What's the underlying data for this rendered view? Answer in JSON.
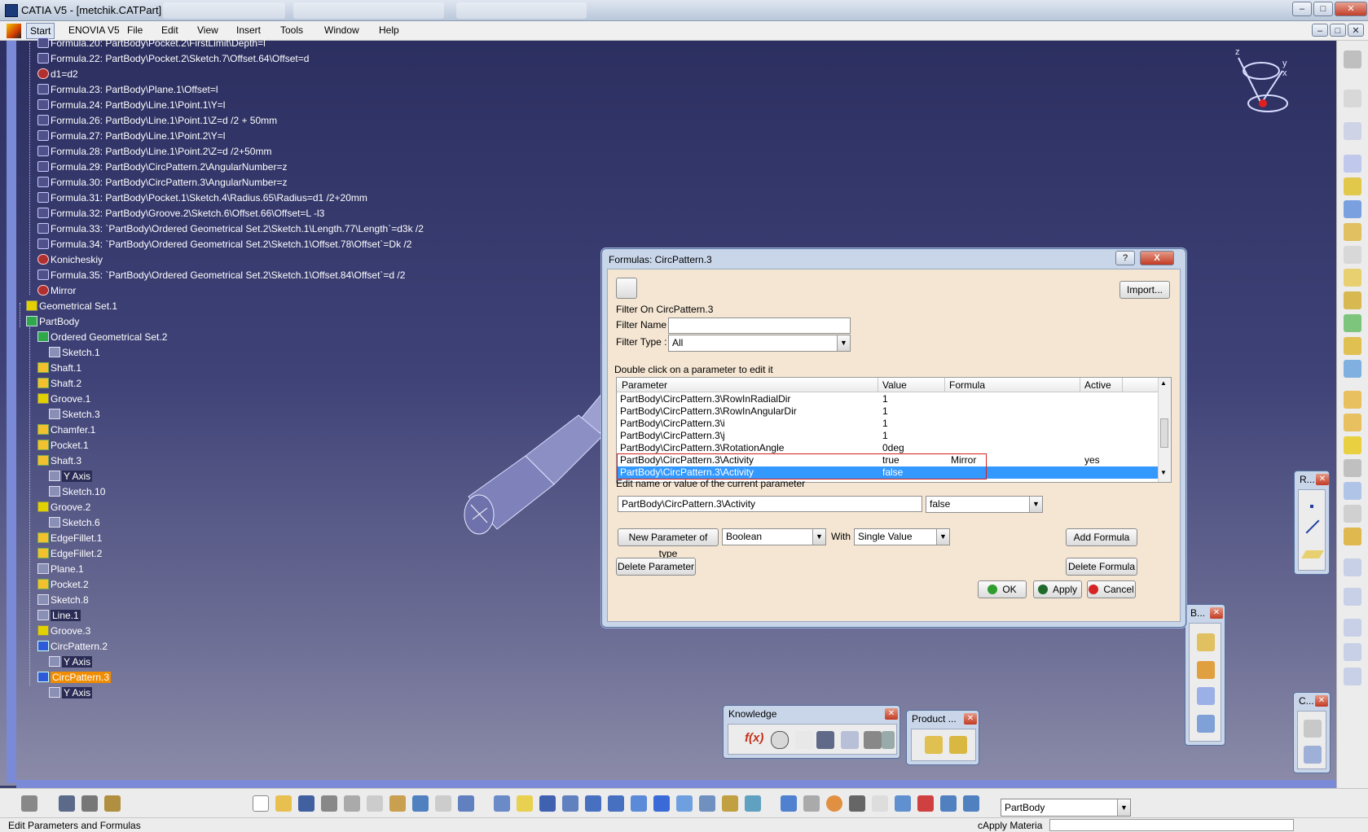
{
  "window": {
    "title": "CATIA V5 - [metchik.CATPart]"
  },
  "menu": {
    "items": [
      "Start",
      "ENOVIA V5",
      "File",
      "Edit",
      "View",
      "Insert",
      "Tools",
      "Window",
      "Help"
    ]
  },
  "tree": {
    "rows": [
      {
        "label": "Formula.20: PartBody\\Pocket.2\\FirstLimit\\Depth=l",
        "icon": "formula-icon"
      },
      {
        "label": "Formula.22: PartBody\\Pocket.2\\Sketch.7\\Offset.64\\Offset=d",
        "icon": "formula-icon"
      },
      {
        "label": "d1=d2",
        "icon": "rule-icon"
      },
      {
        "label": "Formula.23: PartBody\\Plane.1\\Offset=l",
        "icon": "formula-icon"
      },
      {
        "label": "Formula.24: PartBody\\Line.1\\Point.1\\Y=l",
        "icon": "formula-icon"
      },
      {
        "label": "Formula.26: PartBody\\Line.1\\Point.1\\Z=d /2 + 50mm",
        "icon": "formula-icon"
      },
      {
        "label": "Formula.27: PartBody\\Line.1\\Point.2\\Y=l",
        "icon": "formula-icon"
      },
      {
        "label": "Formula.28: PartBody\\Line.1\\Point.2\\Z=d /2+50mm",
        "icon": "formula-icon"
      },
      {
        "label": "Formula.29: PartBody\\CircPattern.2\\AngularNumber=z",
        "icon": "formula-icon"
      },
      {
        "label": "Formula.30: PartBody\\CircPattern.3\\AngularNumber=z",
        "icon": "formula-icon"
      },
      {
        "label": "Formula.31: PartBody\\Pocket.1\\Sketch.4\\Radius.65\\Radius=d1 /2+20mm",
        "icon": "formula-icon"
      },
      {
        "label": "Formula.32: PartBody\\Groove.2\\Sketch.6\\Offset.66\\Offset=L -l3",
        "icon": "formula-icon"
      },
      {
        "label": "Formula.33: `PartBody\\Ordered Geometrical Set.2\\Sketch.1\\Length.77\\Length`=d3k /2",
        "icon": "formula-icon"
      },
      {
        "label": "Formula.34: `PartBody\\Ordered Geometrical Set.2\\Sketch.1\\Offset.78\\Offset`=Dk /2",
        "icon": "formula-icon"
      },
      {
        "label": "Konicheskiy",
        "icon": "rule-icon"
      },
      {
        "label": "Formula.35: `PartBody\\Ordered Geometrical Set.2\\Sketch.1\\Offset.84\\Offset`=d /2",
        "icon": "formula-icon"
      },
      {
        "label": "Mirror",
        "icon": "rule-icon"
      },
      {
        "label": "Geometrical Set.1",
        "icon": "geoset-icon"
      },
      {
        "label": "PartBody",
        "icon": "partbody-icon"
      },
      {
        "label": "Ordered Geometrical Set.2",
        "icon": "geoset-icon"
      },
      {
        "label": "Sketch.1",
        "icon": "sketch-icon"
      },
      {
        "label": "Shaft.1",
        "icon": "shaft-icon"
      },
      {
        "label": "Shaft.2",
        "icon": "shaft-icon"
      },
      {
        "label": "Groove.1",
        "icon": "groove-icon"
      },
      {
        "label": "Sketch.3",
        "icon": "sketch-icon"
      },
      {
        "label": "Chamfer.1",
        "icon": "chamfer-icon"
      },
      {
        "label": "Pocket.1",
        "icon": "pocket-icon"
      },
      {
        "label": "Shaft.3",
        "icon": "shaft-icon"
      },
      {
        "label": "Y Axis",
        "icon": "axis-icon"
      },
      {
        "label": "Sketch.10",
        "icon": "sketch-icon"
      },
      {
        "label": "Groove.2",
        "icon": "groove-icon"
      },
      {
        "label": "Sketch.6",
        "icon": "sketch-icon"
      },
      {
        "label": "EdgeFillet.1",
        "icon": "fillet-icon"
      },
      {
        "label": "EdgeFillet.2",
        "icon": "fillet-icon"
      },
      {
        "label": "Plane.1",
        "icon": "plane-icon"
      },
      {
        "label": "Pocket.2",
        "icon": "pocket-icon"
      },
      {
        "label": "Sketch.8",
        "icon": "sketch-icon"
      },
      {
        "label": "Line.1",
        "icon": "line-icon"
      },
      {
        "label": "Groove.3",
        "icon": "groove-icon"
      },
      {
        "label": "CircPattern.2",
        "icon": "pattern-icon"
      },
      {
        "label": "Y Axis",
        "icon": "axis-icon"
      },
      {
        "label": "CircPattern.3",
        "icon": "pattern-icon",
        "selected": true
      },
      {
        "label": "Y Axis",
        "icon": "axis-icon"
      }
    ]
  },
  "compass": {
    "z": "z",
    "y": "y",
    "x": "x"
  },
  "dialog": {
    "title": "Formulas: CircPattern.3",
    "help": "?",
    "close": "X",
    "import_label": "Import...",
    "filter_on": "Filter On CircPattern.3",
    "filter_name_label": "Filter Name :",
    "filter_name_value": "",
    "filter_type_label": "Filter Type :",
    "filter_type_value": "All",
    "instruction": "Double click on a parameter to edit it",
    "columns": {
      "parameter": "Parameter",
      "value": "Value",
      "formula": "Formula",
      "active": "Active"
    },
    "rows": [
      {
        "parameter": "PartBody\\CircPattern.3\\RowInRadialDir",
        "value": "1",
        "formula": "",
        "active": ""
      },
      {
        "parameter": "PartBody\\CircPattern.3\\RowInAngularDir",
        "value": "1",
        "formula": "",
        "active": ""
      },
      {
        "parameter": "PartBody\\CircPattern.3\\i",
        "value": "1",
        "formula": "",
        "active": ""
      },
      {
        "parameter": "PartBody\\CircPattern.3\\j",
        "value": "1",
        "formula": "",
        "active": ""
      },
      {
        "parameter": "PartBody\\CircPattern.3\\RotationAngle",
        "value": "0deg",
        "formula": "",
        "active": ""
      },
      {
        "parameter": "PartBody\\CircPattern.3\\Activity",
        "value": "true",
        "formula": "Mirror",
        "active": "yes"
      },
      {
        "parameter": "PartBody\\CircPattern.3\\Activity",
        "value": "false",
        "formula": "",
        "active": "",
        "selected": true
      }
    ],
    "edit_label": "Edit name or value of the current parameter",
    "edit_name_value": "PartBody\\CircPattern.3\\Activity",
    "edit_value_value": "false",
    "new_param_label": "New Parameter of type",
    "new_param_type": "Boolean",
    "with_label": "With",
    "with_value": "Single Value",
    "add_formula_label": "Add Formula",
    "delete_param_label": "Delete Parameter",
    "delete_formula_label": "Delete Formula",
    "ok_label": "OK",
    "apply_label": "Apply",
    "cancel_label": "Cancel",
    "colors": {
      "ok": "#2f9e2f",
      "apply": "#1f6b2a",
      "cancel": "#d42424",
      "selection": "#3399ff",
      "highlight_box": "#d61f1f"
    }
  },
  "toolbars": {
    "knowledge_title": "Knowledge",
    "product_title": "Product ...",
    "r_title": "R...",
    "b_title": "B...",
    "c_title": "C..."
  },
  "bottom": {
    "partbody_select": "PartBody"
  },
  "status": {
    "left_text": "Edit Parameters and Formulas",
    "right_text": "cApply Materia"
  }
}
